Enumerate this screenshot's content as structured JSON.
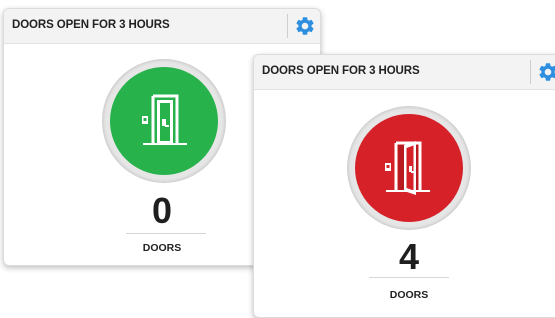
{
  "colors": {
    "closed": "#28b24b",
    "open": "#d62128",
    "gear": "#2e8fe0"
  },
  "widgets": [
    {
      "title": "DOORS OPEN FOR 3 HOURS",
      "settings_icon": "gear-icon",
      "status_icon": "door-closed-icon",
      "count": "0",
      "unit": "DOORS"
    },
    {
      "title": "DOORS OPEN FOR 3 HOURS",
      "settings_icon": "gear-icon",
      "status_icon": "door-open-icon",
      "count": "4",
      "unit": "DOORS"
    }
  ]
}
